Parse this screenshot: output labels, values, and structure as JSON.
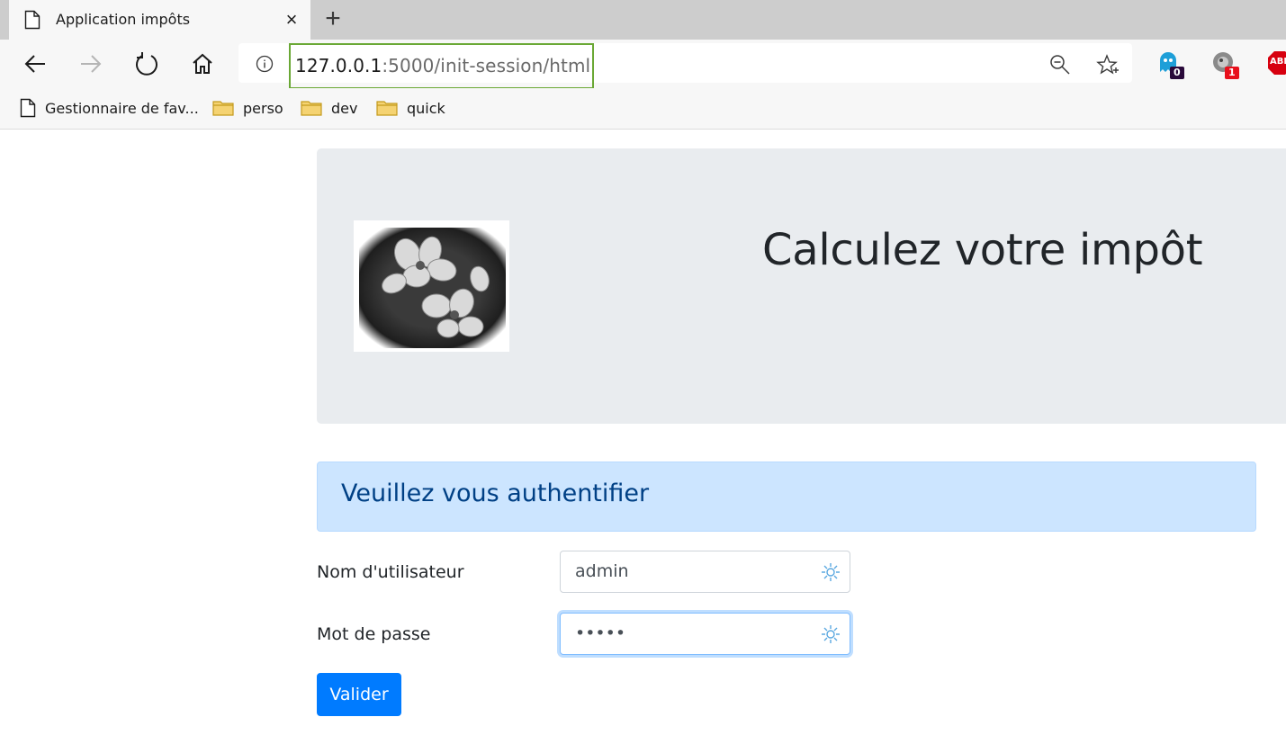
{
  "browser": {
    "tab_title": "Application impôts",
    "tab_close": "×",
    "new_tab": "+",
    "url_host": "127.0.0.1",
    "url_rest": ":5000/init-session/html",
    "extensions": [
      {
        "name": "ghostery",
        "badge": "0",
        "badge_color": "#2a0a3a"
      },
      {
        "name": "privacy-badger",
        "badge": "1",
        "badge_color": "#e8101c"
      },
      {
        "name": "adblock-plus",
        "label": "ABP"
      }
    ],
    "bookmarks": [
      {
        "label": "Gestionnaire de fav...",
        "icon": "page-icon"
      },
      {
        "label": "perso",
        "icon": "folder-icon"
      },
      {
        "label": "dev",
        "icon": "folder-icon"
      },
      {
        "label": "quick",
        "icon": "folder-icon"
      }
    ]
  },
  "page": {
    "title": "Calculez votre impôt",
    "alert_title": "Veuillez vous authentifier",
    "form": {
      "username_label": "Nom d'utilisateur",
      "username_value": "admin",
      "password_label": "Mot de passe",
      "password_value": "•••••",
      "submit_label": "Valider"
    }
  },
  "colors": {
    "accent": "#007bff",
    "alert_bg": "#cce5ff",
    "alert_text": "#004085",
    "jumbotron_bg": "#e9ecef",
    "url_highlight": "#6aa835"
  }
}
